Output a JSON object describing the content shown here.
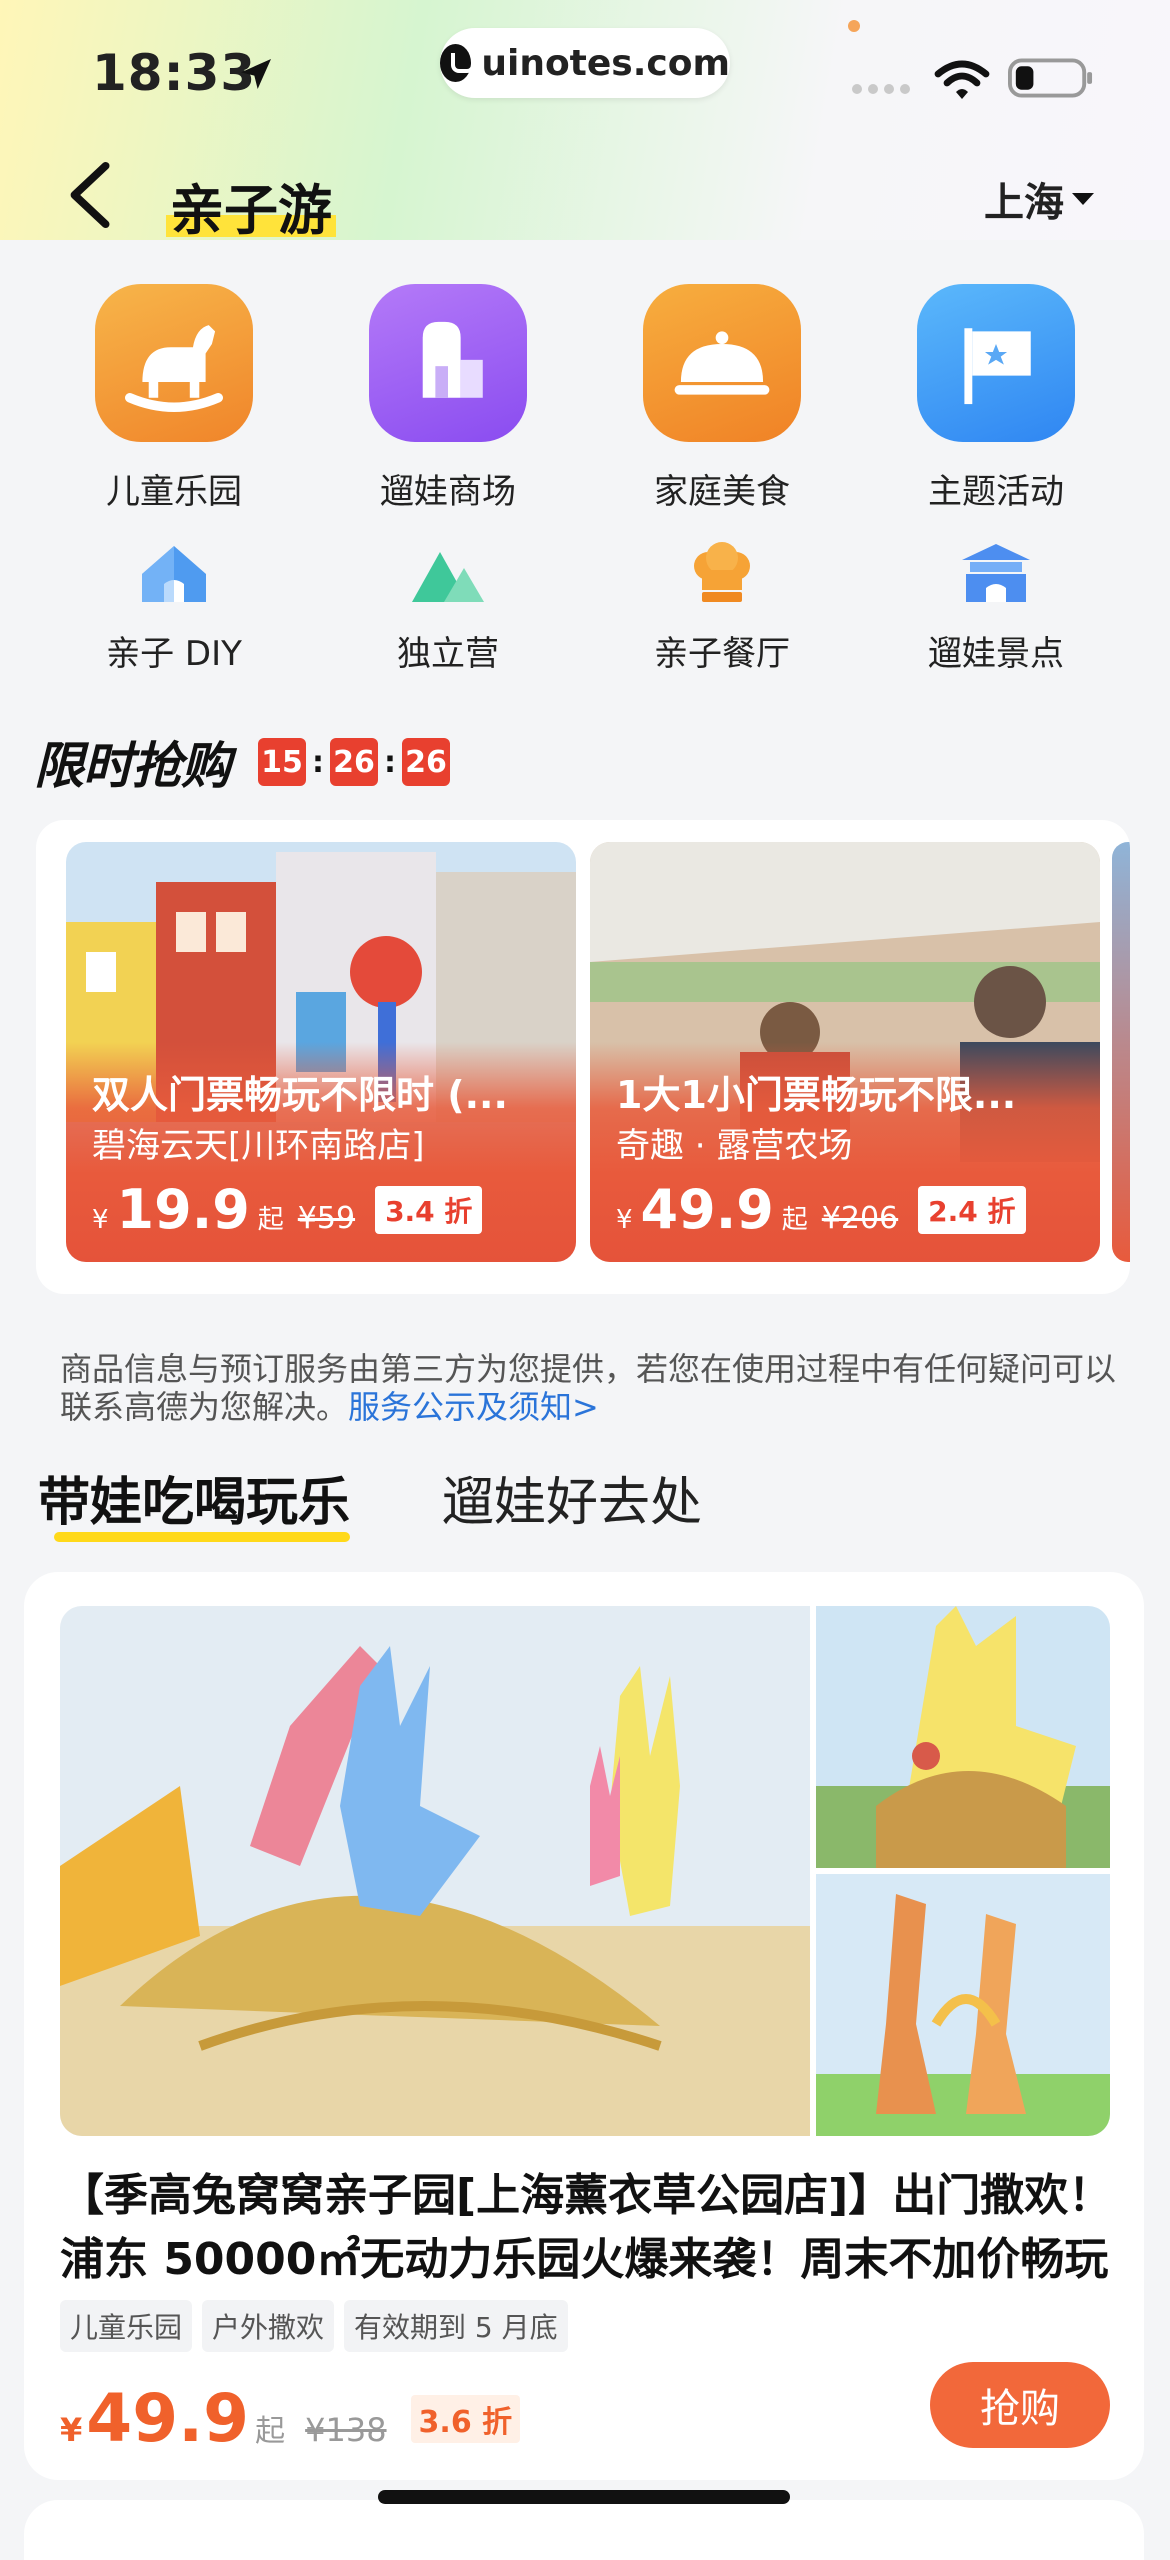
{
  "status_bar": {
    "time": "18:33",
    "url": "uinotes.com"
  },
  "nav": {
    "title": "亲子游",
    "city": "上海"
  },
  "categories_primary": [
    {
      "label": "儿童乐园",
      "icon": "rocking-horse-icon",
      "color": "#f39a2c"
    },
    {
      "label": "遛娃商场",
      "icon": "mall-building-icon",
      "color": "#9b62f0"
    },
    {
      "label": "家庭美食",
      "icon": "food-cloche-icon",
      "color": "#f5962e"
    },
    {
      "label": "主题活动",
      "icon": "flag-icon",
      "color": "#3d9bf5"
    }
  ],
  "categories_secondary": [
    {
      "label": "亲子 DIY",
      "icon": "house-icon"
    },
    {
      "label": "独立营",
      "icon": "mountain-icon"
    },
    {
      "label": "亲子餐厅",
      "icon": "chef-hat-icon"
    },
    {
      "label": "遛娃景点",
      "icon": "pavilion-icon"
    }
  ],
  "flash_sale": {
    "title": "限时抢购",
    "timer": {
      "h": "15",
      "m": "26",
      "s": "26"
    },
    "deals": [
      {
        "title": "双人门票畅玩不限时 (...",
        "shop": "碧海云天[川环南路店]",
        "yen": "¥",
        "price": "19.9",
        "qi": "起",
        "orig": "¥59",
        "discount": "3.4 折"
      },
      {
        "title": "1大1小门票畅玩不限...",
        "shop": "奇趣 · 露营农场",
        "yen": "¥",
        "price": "49.9",
        "qi": "起",
        "orig": "¥206",
        "discount": "2.4 折"
      }
    ]
  },
  "notice": {
    "text": "商品信息与预订服务由第三方为您提供，若您在使用过程中有任何疑问可以联系高德为您解决。",
    "link": "服务公示及须知>"
  },
  "tabs": {
    "active": "带娃吃喝玩乐",
    "inactive": "遛娃好去处"
  },
  "product": {
    "title": "【季高兔窝窝亲子园[上海薰衣草公园店]】出门撒欢！浦东 50000㎡无动力乐园火爆来袭！周末不加价畅玩",
    "tags": [
      "儿童乐园",
      "户外撒欢",
      "有效期到 5 月底"
    ],
    "yen": "¥",
    "price": "49.9",
    "qi": "起",
    "orig": "¥138",
    "discount": "3.6 折",
    "buy_label": "抢购"
  }
}
